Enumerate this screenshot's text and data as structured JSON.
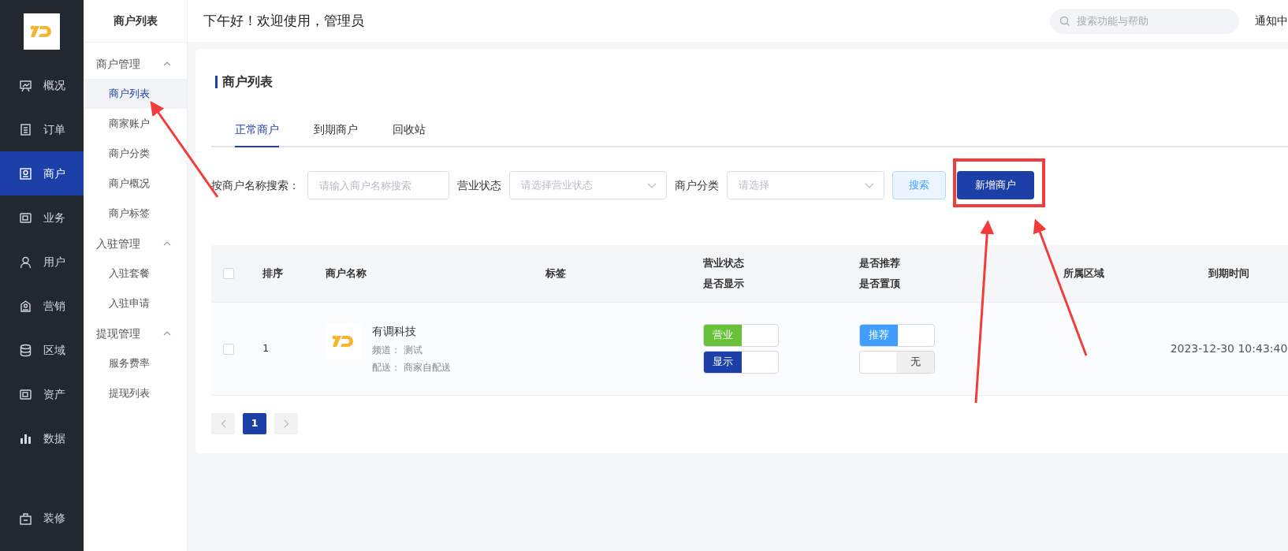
{
  "sidebar": {
    "items": [
      {
        "label": "概况",
        "selected": false
      },
      {
        "label": "订单",
        "selected": false
      },
      {
        "label": "商户",
        "selected": true
      },
      {
        "label": "业务",
        "selected": false
      },
      {
        "label": "用户",
        "selected": false
      },
      {
        "label": "营销",
        "selected": false
      },
      {
        "label": "区域",
        "selected": false
      },
      {
        "label": "资产",
        "selected": false
      },
      {
        "label": "数据",
        "selected": false
      },
      {
        "label": "装修",
        "selected": false
      }
    ]
  },
  "submenu": {
    "title": "商户列表",
    "groups": [
      {
        "label": "商户管理",
        "expanded": true,
        "children": [
          {
            "label": "商户列表",
            "selected": true
          },
          {
            "label": "商家账户",
            "selected": false
          },
          {
            "label": "商户分类",
            "selected": false
          },
          {
            "label": "商户概况",
            "selected": false
          },
          {
            "label": "商户标签",
            "selected": false
          }
        ]
      },
      {
        "label": "入驻管理",
        "expanded": true,
        "children": [
          {
            "label": "入驻套餐",
            "selected": false
          },
          {
            "label": "入驻申请",
            "selected": false
          }
        ]
      },
      {
        "label": "提现管理",
        "expanded": true,
        "children": [
          {
            "label": "服务费率",
            "selected": false
          },
          {
            "label": "提现列表",
            "selected": false
          }
        ]
      }
    ]
  },
  "header": {
    "greeting": "下午好！欢迎使用，管理员",
    "search": {
      "placeholder": "搜索功能与帮助"
    },
    "notice": "通知中"
  },
  "page": {
    "title": "商户列表",
    "tabs": [
      {
        "label": "正常商户",
        "selected": true
      },
      {
        "label": "到期商户",
        "selected": false
      },
      {
        "label": "回收站",
        "selected": false
      }
    ],
    "filters": [
      {
        "kind": "text",
        "label": "按商户名称搜索：",
        "placeholder": "请输入商户名称搜索"
      },
      {
        "kind": "select",
        "label": "营业状态",
        "placeholder": "请选择营业状态"
      },
      {
        "kind": "select",
        "label": "商户分类",
        "placeholder": "请选择"
      }
    ],
    "buttons": [
      {
        "kind": "light",
        "label": "搜索"
      },
      {
        "kind": "primary",
        "label": "新增商户"
      }
    ]
  },
  "table": {
    "select_all": {
      "checked": false
    },
    "columns": [
      {
        "label": "排序"
      },
      {
        "label": "商户名称"
      },
      {
        "label": "标签"
      },
      {
        "label": "营业状态",
        "sublabel": "是否显示"
      },
      {
        "label": "是否推荐",
        "sublabel": "是否置顶"
      },
      {
        "label": "所属区域"
      },
      {
        "label": "到期时间"
      }
    ],
    "rows": [
      {
        "selected": false,
        "index": "1",
        "name": "有调科技",
        "channel": "频道： 测试",
        "delivery": "配送： 商家自配送",
        "status_toggles": [
          {
            "label": "营业",
            "on": true,
            "color": "#67c23a"
          },
          {
            "label": "显示",
            "on": true,
            "color": "#1c3fa8"
          }
        ],
        "recommend_toggles": [
          {
            "label": "推荐",
            "on": true,
            "color": "#409eff"
          },
          {
            "label": "无",
            "on": false
          }
        ],
        "expires": "2023-12-30 10:43:40"
      }
    ]
  },
  "pagination": {
    "pages": [
      {
        "label": "1",
        "selected": true
      }
    ]
  }
}
